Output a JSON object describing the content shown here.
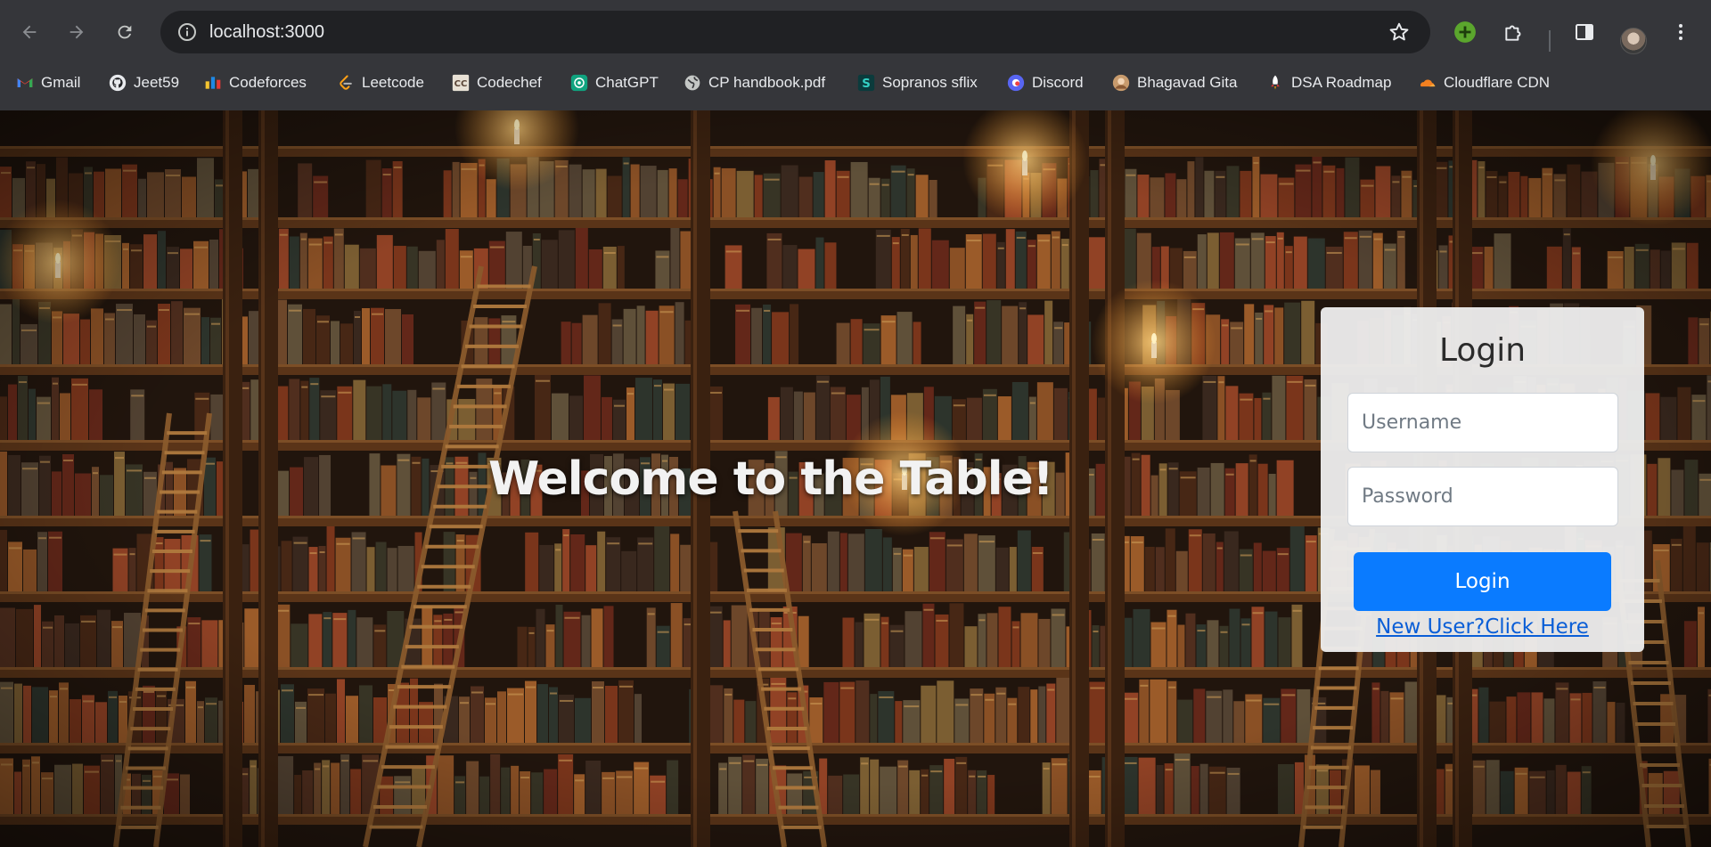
{
  "browser": {
    "url": "localhost:3000",
    "bookmarks": [
      {
        "label": "Gmail",
        "icon": "gmail-icon"
      },
      {
        "label": "Jeet59",
        "icon": "github-icon"
      },
      {
        "label": "Codeforces",
        "icon": "codeforces-icon"
      },
      {
        "label": "Leetcode",
        "icon": "leetcode-icon"
      },
      {
        "label": "Codechef",
        "icon": "codechef-icon"
      },
      {
        "label": "ChatGPT",
        "icon": "chatgpt-icon"
      },
      {
        "label": "CP handbook.pdf",
        "icon": "globe-icon"
      },
      {
        "label": "Sopranos sflix",
        "icon": "sflix-icon"
      },
      {
        "label": "Discord",
        "icon": "discord-icon"
      },
      {
        "label": "Bhagavad Gita",
        "icon": "bhagavad-gita-icon"
      },
      {
        "label": "DSA Roadmap",
        "icon": "dsa-roadmap-icon"
      },
      {
        "label": "Cloudflare CDN",
        "icon": "cloudflare-icon"
      }
    ]
  },
  "page": {
    "welcome": "Welcome to the Table!",
    "login": {
      "title": "Login",
      "username_placeholder": "Username",
      "password_placeholder": "Password",
      "button": "Login",
      "signup_link": "New User?Click Here"
    }
  },
  "colors": {
    "chrome": "#35363a",
    "omnibox": "#202124",
    "button": "#0a7bff",
    "link": "#0a5ed7",
    "card": "#ececec"
  }
}
